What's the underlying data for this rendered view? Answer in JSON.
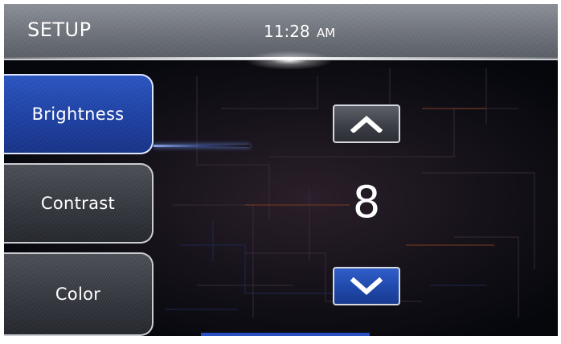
{
  "header": {
    "title": "SETUP",
    "time": "11:28",
    "ampm": "AM"
  },
  "menu": {
    "items": [
      {
        "label": "Brightness",
        "active": true
      },
      {
        "label": "Contrast",
        "active": false
      },
      {
        "label": "Color",
        "active": false
      }
    ]
  },
  "control": {
    "value": "8",
    "up_icon": "chevron-up-icon",
    "down_icon": "chevron-down-icon"
  },
  "colors": {
    "active_blue": "#1c3fa3",
    "inactive_gray": "#33363d",
    "header_gray": "#6f737b"
  }
}
